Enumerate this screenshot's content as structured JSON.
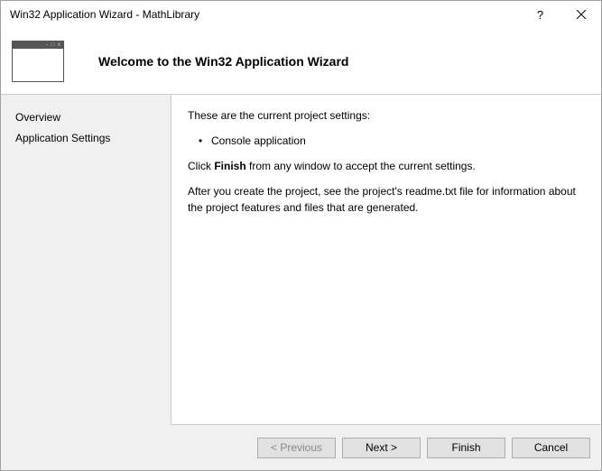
{
  "titlebar": {
    "title": "Win32 Application Wizard - MathLibrary",
    "help": "?",
    "close": "×"
  },
  "header": {
    "title": "Welcome to the Win32 Application Wizard"
  },
  "sidebar": {
    "items": [
      {
        "label": "Overview"
      },
      {
        "label": "Application Settings"
      }
    ]
  },
  "main": {
    "intro": "These are the current project settings:",
    "bullet": "Console application",
    "finish_prefix": "Click ",
    "finish_bold": "Finish",
    "finish_suffix": " from any window to accept the current settings.",
    "after": "After you create the project, see the project's readme.txt file for information about the project features and files that are generated."
  },
  "buttons": {
    "previous": "< Previous",
    "next": "Next >",
    "finish": "Finish",
    "cancel": "Cancel"
  }
}
